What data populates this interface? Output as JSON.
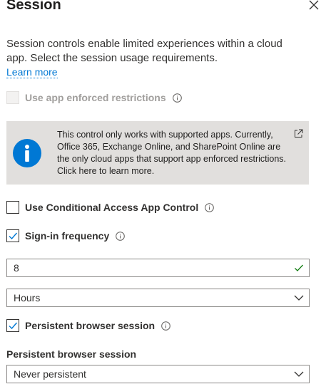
{
  "panel": {
    "title": "Session",
    "description": "Session controls enable limited experiences within a cloud app. Select the session usage requirements.",
    "learn_more": "Learn more"
  },
  "controls": {
    "app_enforced": {
      "label": "Use app enforced restrictions",
      "checked": false,
      "disabled": true
    },
    "notice": "This control only works with supported apps. Currently, Office 365, Exchange Online, and SharePoint Online are the only cloud apps that support app enforced restrictions. Click here to learn more.",
    "conditional_access": {
      "label": "Use Conditional Access App Control",
      "checked": false
    },
    "signin_frequency": {
      "label": "Sign-in frequency",
      "checked": true,
      "value": "8",
      "unit": "Hours"
    },
    "persistent_browser": {
      "label": "Persistent browser session",
      "checked": true
    },
    "persistent_select": {
      "label": "Persistent browser session",
      "value": "Never persistent"
    }
  },
  "colors": {
    "accent": "#0078d4",
    "valid": "#107c10",
    "banner_bg": "#e1dfdd",
    "info_icon": "#0078d4"
  }
}
